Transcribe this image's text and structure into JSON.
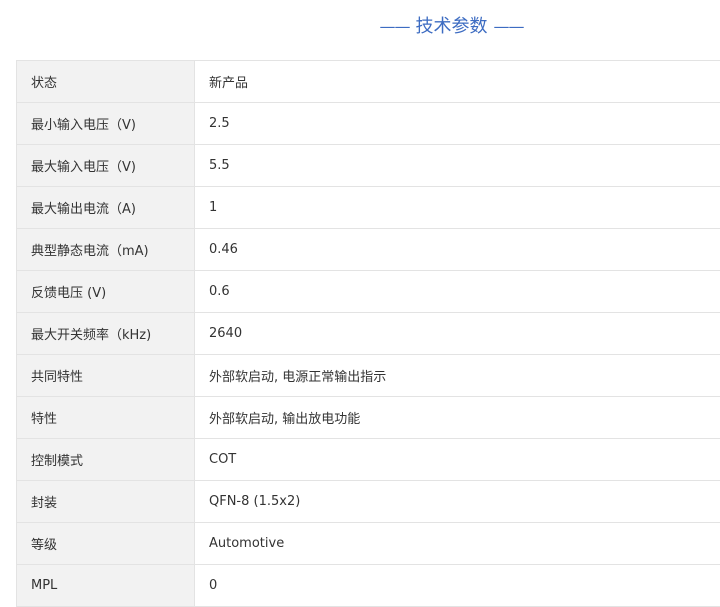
{
  "section": {
    "title": "技术参数",
    "left_dash": "——",
    "right_dash": "——"
  },
  "colors": {
    "title": "#3d6cc2",
    "label_bg": "#f2f2f2",
    "border": "#e3e3e3",
    "text": "#333333"
  },
  "specs": [
    {
      "label": "状态",
      "value": "新产品"
    },
    {
      "label": "最小输入电压（V)",
      "value": "2.5"
    },
    {
      "label": "最大输入电压（V)",
      "value": "5.5"
    },
    {
      "label": "最大输出电流（A)",
      "value": "1"
    },
    {
      "label": "典型静态电流（mA)",
      "value": "0.46"
    },
    {
      "label": "反馈电压 (V)",
      "value": "0.6"
    },
    {
      "label": "最大开关频率（kHz)",
      "value": "2640"
    },
    {
      "label": "共同特性",
      "value": "外部软启动, 电源正常输出指示"
    },
    {
      "label": "特性",
      "value": "外部软启动, 输出放电功能"
    },
    {
      "label": "控制模式",
      "value": "COT"
    },
    {
      "label": "封装",
      "value": "QFN-8 (1.5x2)"
    },
    {
      "label": "等级",
      "value": "Automotive"
    },
    {
      "label": "MPL",
      "value": "0"
    }
  ]
}
